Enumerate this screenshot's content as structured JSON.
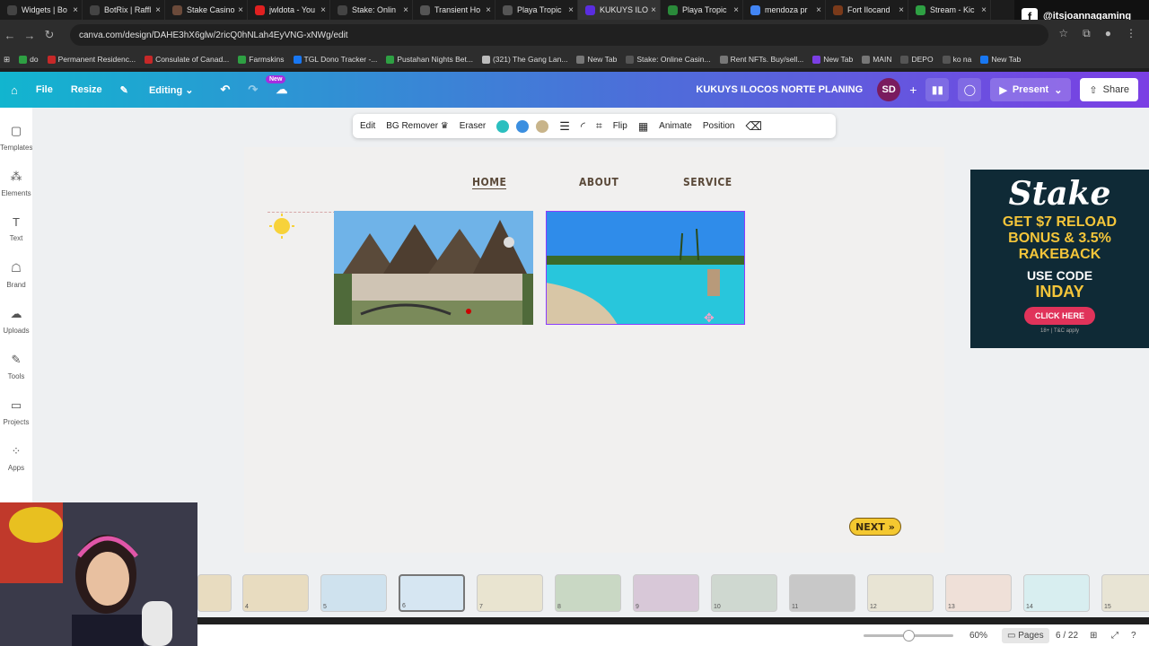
{
  "browser": {
    "tabs": [
      {
        "label": "Widgets | Bo",
        "color": "#444"
      },
      {
        "label": "BotRix | Raffl",
        "color": "#444"
      },
      {
        "label": "Stake Casino",
        "color": "#6b4a3a"
      },
      {
        "label": "jwldota - You",
        "color": "#e02020"
      },
      {
        "label": "Stake: Onlin",
        "color": "#444"
      },
      {
        "label": "Transient Ho",
        "color": "#555"
      },
      {
        "label": "Playa Tropic",
        "color": "#555"
      },
      {
        "label": "KUKUYS ILO",
        "color": "#5a2de0"
      },
      {
        "label": "Playa Tropic",
        "color": "#2a8a3a"
      },
      {
        "label": "mendoza pr",
        "color": "#4285f4"
      },
      {
        "label": "Fort Ilocand",
        "color": "#7a3a1a"
      },
      {
        "label": "Stream - Kic",
        "color": "#2ea043"
      }
    ],
    "url": "canva.com/design/DAHE3hX6glw/2ricQ0hNLah4EyVNG-xNWg/edit",
    "bookmarks": [
      "do",
      "Permanent Residenc...",
      "Consulate of Canad...",
      "Farmskins",
      "TGL Dono Tracker -...",
      "Pustahan Nights Bet...",
      "(321) The Gang Lan...",
      "New Tab",
      "Stake: Online Casin...",
      "Rent NFTs. Buy/sell...",
      "New Tab",
      "MAIN",
      "DEPO",
      "ko na",
      "New Tab"
    ]
  },
  "overlay": {
    "handle": "@itsjoannagaming"
  },
  "canva": {
    "menu": {
      "file": "File",
      "resize": "Resize",
      "editing": "Editing",
      "new_badge": "New"
    },
    "project_title": "KUKUYS ILOCOS NORTE PLANING",
    "avatar": "SD",
    "present": "Present",
    "share": "Share",
    "sidebar": [
      "Templates",
      "Elements",
      "Text",
      "Brand",
      "Uploads",
      "Tools",
      "Projects",
      "Apps"
    ],
    "toolbar": {
      "edit": "Edit",
      "bg_remover": "BG Remover",
      "eraser": "Eraser",
      "flip": "Flip",
      "animate": "Animate",
      "position": "Position"
    },
    "swatches": [
      "#2bbfbf",
      "#3b8fe0",
      "#c8b48a"
    ],
    "page_nav": [
      "HOME",
      "ABOUT",
      "SERVICE"
    ],
    "next_btn": "NEXT",
    "thumbs": [
      "4",
      "5",
      "6",
      "7",
      "8",
      "9",
      "10",
      "11",
      "12",
      "13",
      "14",
      "15"
    ],
    "zoom": "60%",
    "pages_label": "Pages",
    "page_count": "6 / 22"
  },
  "ad": {
    "brand": "Stake",
    "line1": "GET $7 RELOAD",
    "line2": "BONUS & 3.5%",
    "line3": "RAKEBACK",
    "line4": "USE CODE",
    "code": "INDAY",
    "cta": "CLICK HERE",
    "fine": "18+ | T&C apply"
  }
}
